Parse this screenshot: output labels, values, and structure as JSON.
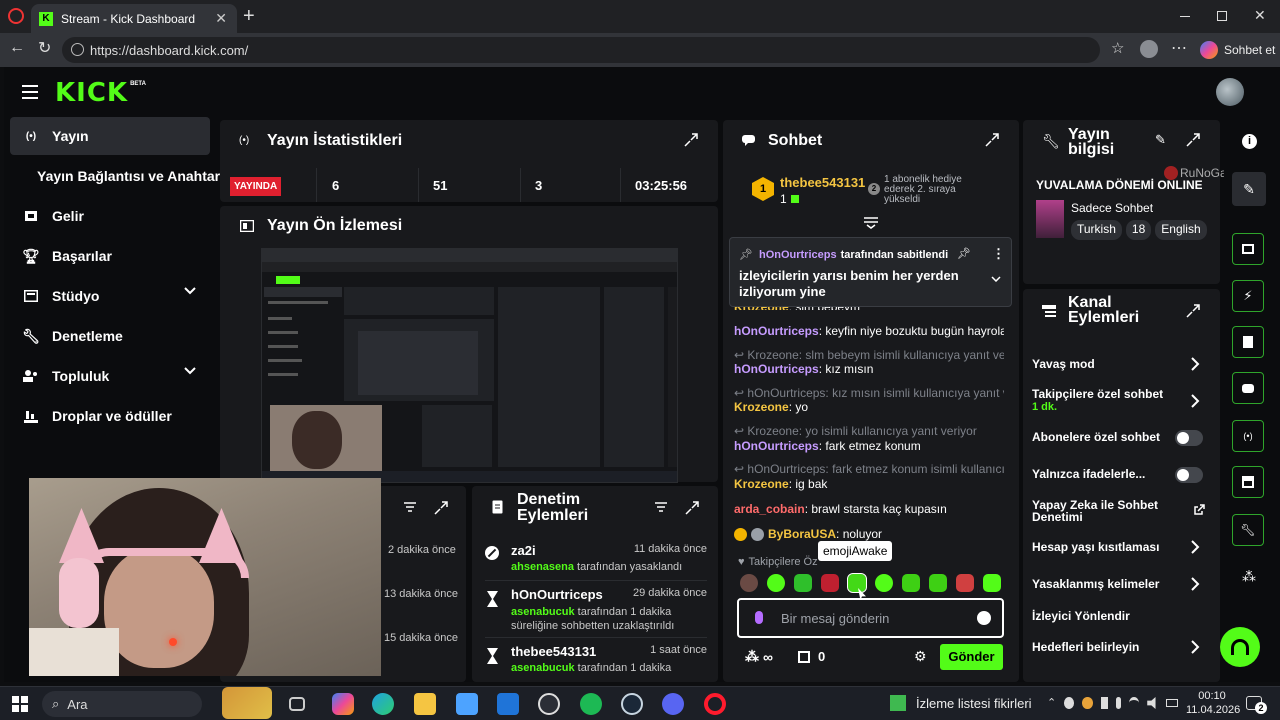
{
  "browser": {
    "tab_title": "Stream - Kick Dashboard",
    "url": "https://dashboard.kick.com/",
    "copilot_label": "Sohbet et"
  },
  "app": {
    "logo": "KICK",
    "logo_badge": "BETA"
  },
  "sidebar": {
    "items": [
      {
        "label": "Yayın"
      },
      {
        "label": "Yayın Bağlantısı ve Anahtarı"
      },
      {
        "label": "Gelir"
      },
      {
        "label": "Başarılar"
      },
      {
        "label": "Stüdyo"
      },
      {
        "label": "Denetleme"
      },
      {
        "label": "Topluluk"
      },
      {
        "label": "Droplar ve ödüller"
      }
    ]
  },
  "stats": {
    "title": "Yayın İstatistikleri",
    "live_badge": "YAYINDA",
    "values": [
      "6",
      "51",
      "3",
      "03:25:56"
    ]
  },
  "preview": {
    "title": "Yayın Ön İzlemesi"
  },
  "activity": {
    "times": [
      "2 dakika önce",
      "13 dakika önce",
      "15 dakika önce"
    ]
  },
  "moderation": {
    "title": "Denetim Eylemleri",
    "entries": [
      {
        "user": "za2i",
        "time": "11 dakika önce",
        "moderator": "ahsenasena",
        "action": "tarafından yasaklandı"
      },
      {
        "user": "hOnOurtriceps",
        "time": "29 dakika önce",
        "moderator": "asenabucuk",
        "action": "tarafından 1 dakika süreliğine sohbetten uzaklaştırıldı"
      },
      {
        "user": "thebee543131",
        "time": "1 saat önce",
        "moderator": "asenabucuk",
        "action": "tarafından 1 dakika"
      }
    ]
  },
  "chat": {
    "title": "Sohbet",
    "top_gifter": {
      "name": "thebee543131",
      "count": "1",
      "note": "1 abonelik hediye ederek 2. sıraya yükseldi",
      "rank": "2"
    },
    "pinned": {
      "author": "hOnOurtriceps",
      "suffix": "tarafından sabitlendi",
      "message": "izleyicilerin yarısı benim her yerden izliyorum yine"
    },
    "lines": [
      {
        "type": "msg",
        "user": "Krozeone",
        "text": "slm bebeym",
        "color": "yellow"
      },
      {
        "type": "msg",
        "user": "hOnOurtriceps",
        "text": "keyfin niye bozuktu bugün hayrola",
        "color": "purple"
      },
      {
        "type": "reply",
        "text": "Krozeone: slm bebeym isimli kullanıcıya yanıt veri..."
      },
      {
        "type": "msg",
        "user": "hOnOurtriceps",
        "text": "kız mısın",
        "color": "purple"
      },
      {
        "type": "reply",
        "text": "hOnOurtriceps: kız mısın isimli kullanıcıya yanıt ve..."
      },
      {
        "type": "msg",
        "user": "Krozeone",
        "text": "yo",
        "color": "yellow"
      },
      {
        "type": "reply",
        "text": "Krozeone: yo isimli kullanıcıya yanıt veriyor"
      },
      {
        "type": "msg",
        "user": "hOnOurtriceps",
        "text": "fark etmez konum",
        "color": "purple"
      },
      {
        "type": "reply",
        "text": "hOnOurtriceps: fark etmez konum isimli kullanıcıy..."
      },
      {
        "type": "msg",
        "user": "Krozeone",
        "text": "ig bak",
        "color": "yellow"
      },
      {
        "type": "msg",
        "user": "arda_cobain",
        "text": "brawl starsta kaç kupasın",
        "color": "red"
      },
      {
        "type": "msg",
        "user": "ByBoraUSA",
        "text": "noluyor",
        "color": "yellow"
      }
    ],
    "followers_only_label": "Takipçilere Öz",
    "emote_tooltip": "emojiAwake",
    "input_placeholder": "Bir mesaj gönderin",
    "points": "∞",
    "chest_count": "0",
    "send_label": "Gönder"
  },
  "stream_info": {
    "title": "Yayın bilgisi",
    "stream_title": "YUVALAMA DÖNEMİ ONLINE",
    "category": "Sadece Sohbet",
    "tags": [
      "Turkish",
      "18",
      "English"
    ],
    "watermark": "RuNoGame"
  },
  "channel_actions": {
    "title": "Kanal Eylemleri",
    "items": [
      {
        "label": "Yavaş mod",
        "control": "chevron"
      },
      {
        "label": "Takipçilere özel sohbet",
        "sub": "1 dk.",
        "control": "chevron"
      },
      {
        "label": "Abonelere özel sohbet",
        "control": "toggle"
      },
      {
        "label": "Yalnızca ifadelerle...",
        "control": "toggle"
      },
      {
        "label": "Yapay Zeka ile Sohbet Denetimi",
        "control": "external"
      },
      {
        "label": "Hesap yaşı kısıtlaması",
        "control": "chevron"
      },
      {
        "label": "Yasaklanmış kelimeler",
        "control": "chevron"
      },
      {
        "label": "İzleyici Yönlendir",
        "control": "none"
      },
      {
        "label": "Hedefleri belirleyin",
        "control": "chevron"
      }
    ]
  },
  "taskbar": {
    "search_label": "Ara",
    "notification": "İzleme listesi fikirleri",
    "time": "00:10",
    "date": "11.04.2026",
    "badge": "2"
  }
}
